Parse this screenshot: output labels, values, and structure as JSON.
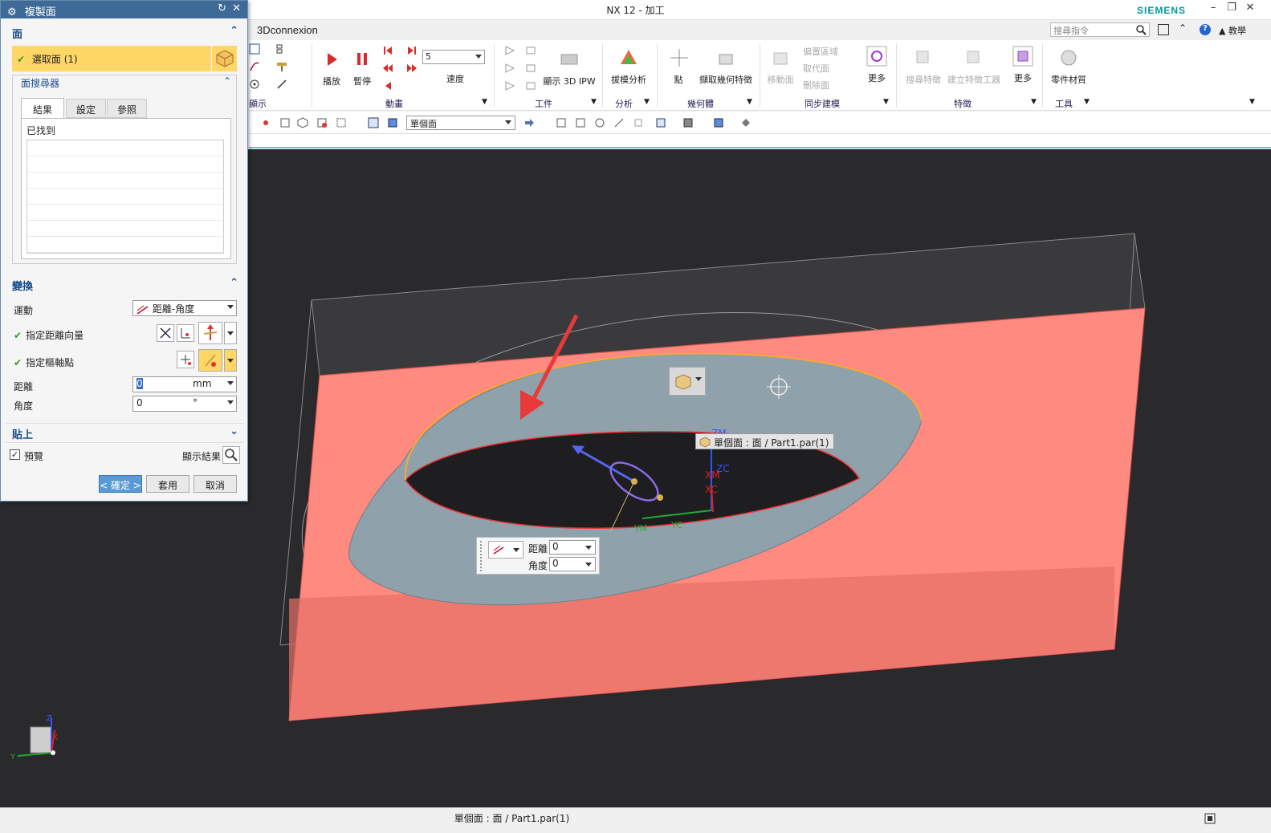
{
  "window": {
    "title": "NX 12 - 加工",
    "brand": "SIEMENS"
  },
  "topbar": {
    "tab": "3Dconnexion",
    "search_placeholder": "搜尋指令",
    "help_label": "教學"
  },
  "ribbon": {
    "groups": {
      "display": "顯示",
      "animation": "動畫",
      "work": "工件",
      "analysis": "分析",
      "geometry": "幾何體",
      "sync": "同步建模",
      "feature": "特徵",
      "tools": "工具"
    },
    "buttons": {
      "play": "播放",
      "pause": "暫停",
      "speed": "速度",
      "speed_value": "5",
      "show_ipw": "顯示 3D IPW",
      "draft_analysis": "拔模分析",
      "point": "點",
      "extract_geometry": "擷取幾何特徵",
      "move_face": "移動面",
      "offset_region": "偏置區域",
      "replace_face": "取代面",
      "delete_face": "刪除面",
      "more1": "更多",
      "search_feature": "搜尋特徵",
      "create_feature_tool": "建立特徵工器",
      "more2": "更多",
      "part_material": "零件材質"
    }
  },
  "selection_bar": {
    "filter_value": "單個面"
  },
  "dialog": {
    "title": "複製面",
    "face_section": "面",
    "select_face": "選取面 (1)",
    "finder_section": "面搜尋器",
    "tabs": [
      "結果",
      "設定",
      "參照"
    ],
    "found_label": "已找到",
    "transform_section": "變換",
    "motion_label": "運動",
    "motion_value": "距離-角度",
    "vector_label": "指定距離向量",
    "pivot_label": "指定樞軸點",
    "distance_label": "距離",
    "distance_value": "0",
    "distance_unit": "mm",
    "angle_label": "角度",
    "angle_value": "0",
    "angle_unit": "°",
    "paste_section": "貼上",
    "preview_label": "預覽",
    "show_result": "顯示結果",
    "ok": "< 確定 >",
    "apply": "套用",
    "cancel": "取消"
  },
  "viewport": {
    "tooltip": "單個面 : 面 / Part1.par(1)",
    "minibar_distance_label": "距離",
    "minibar_distance_value": "0",
    "minibar_angle_label": "角度",
    "minibar_angle_value": "0",
    "axis_labels": {
      "zm": "ZM",
      "zc": "ZC",
      "xm": "XM",
      "xc": "XC",
      "ym": "YM",
      "yc": "YC"
    },
    "triad": {
      "z": "Z",
      "x": "X",
      "y": "Y"
    }
  },
  "status": {
    "text": "單個面 : 面 / Part1.par(1)"
  },
  "colors": {
    "dialog_title": "#3d6a96",
    "selected_row": "#ffd766",
    "face_red": "#ff8a80",
    "viewport_bg": "#2a2a2c"
  }
}
